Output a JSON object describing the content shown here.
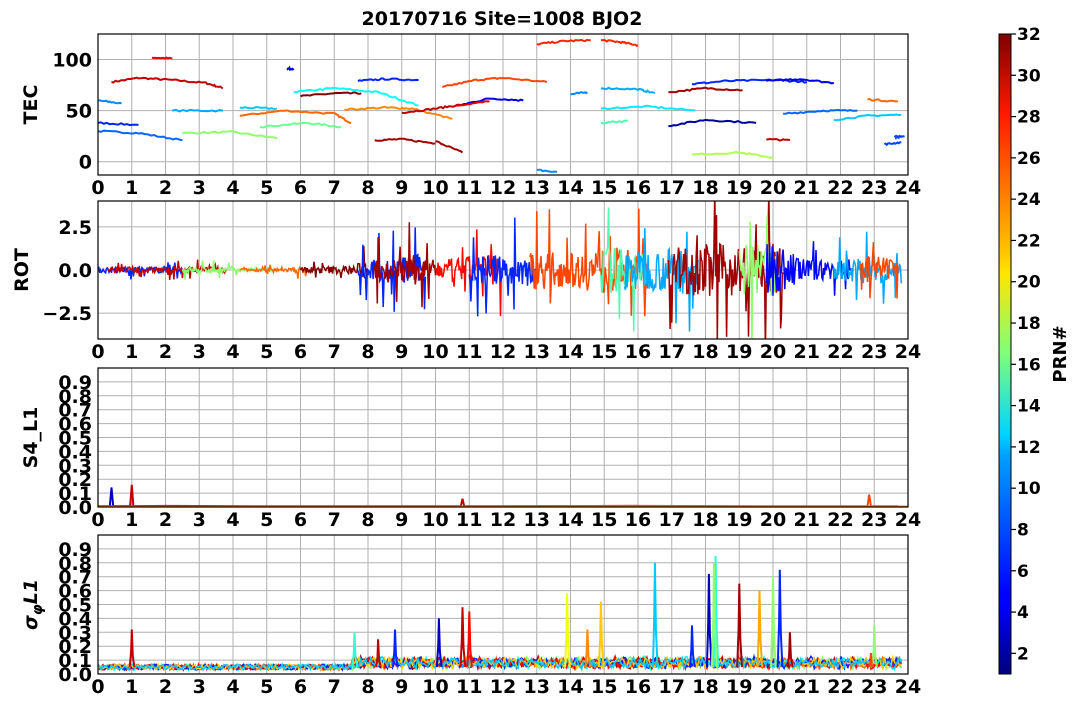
{
  "figure": {
    "title": "20170716 Site=1008 BJO2",
    "colorbar_label": "PRN#",
    "colorbar_range": [
      1,
      32
    ],
    "colorbar_ticks": [
      2,
      4,
      6,
      8,
      10,
      12,
      14,
      16,
      18,
      20,
      22,
      24,
      26,
      28,
      30,
      32
    ],
    "colormap": "jet"
  },
  "chart_data": [
    {
      "type": "line",
      "panel": "TEC",
      "title": "20170716 Site=1008 BJO2",
      "xlabel": "",
      "ylabel": "TEC",
      "xlim": [
        0,
        24
      ],
      "ylim": [
        -13,
        125
      ],
      "xticks": [
        0,
        1,
        2,
        3,
        4,
        5,
        6,
        7,
        8,
        9,
        10,
        11,
        12,
        13,
        14,
        15,
        16,
        17,
        18,
        19,
        20,
        21,
        22,
        23,
        24
      ],
      "yticks": [
        0,
        50,
        100
      ],
      "ytick_labels": [
        "0",
        "50",
        "100"
      ],
      "grid": true,
      "series": [
        {
          "prn": 30,
          "x": [
            0.4,
            1.2,
            2.2,
            3.2,
            3.7
          ],
          "y": [
            78,
            82,
            80,
            77,
            72
          ]
        },
        {
          "prn": 29,
          "x": [
            1.6,
            2.2
          ],
          "y": [
            102,
            101
          ]
        },
        {
          "prn": 9,
          "x": [
            0.0,
            0.7
          ],
          "y": [
            60,
            57
          ]
        },
        {
          "prn": 6,
          "x": [
            0.0,
            1.2
          ],
          "y": [
            38,
            36
          ]
        },
        {
          "prn": 8,
          "x": [
            0.0,
            1.2,
            2.5
          ],
          "y": [
            30,
            28,
            21
          ]
        },
        {
          "prn": 10,
          "x": [
            2.2,
            3.7
          ],
          "y": [
            50,
            50
          ]
        },
        {
          "prn": 17,
          "x": [
            2.5,
            4.0,
            5.3
          ],
          "y": [
            28,
            29,
            23
          ]
        },
        {
          "prn": 11,
          "x": [
            4.2,
            5.3
          ],
          "y": [
            53,
            52
          ]
        },
        {
          "prn": 25,
          "x": [
            4.2,
            5.5,
            7.0,
            7.5
          ],
          "y": [
            45,
            50,
            47,
            38
          ]
        },
        {
          "prn": 16,
          "x": [
            4.8,
            6.2,
            7.2
          ],
          "y": [
            34,
            38,
            34
          ]
        },
        {
          "prn": 4,
          "x": [
            5.6,
            5.8
          ],
          "y": [
            91,
            91
          ]
        },
        {
          "prn": 32,
          "x": [
            6.0,
            7.0,
            7.8
          ],
          "y": [
            64,
            67,
            67
          ]
        },
        {
          "prn": 13,
          "x": [
            5.8,
            7.0,
            8.3,
            9.5
          ],
          "y": [
            68,
            72,
            68,
            55
          ]
        },
        {
          "prn": 24,
          "x": [
            7.3,
            8.5,
            9.3,
            10.5
          ],
          "y": [
            51,
            53,
            52,
            42
          ]
        },
        {
          "prn": 6,
          "x": [
            7.7,
            8.5,
            9.5
          ],
          "y": [
            79,
            81,
            80
          ]
        },
        {
          "prn": 31,
          "x": [
            8.2,
            9.0,
            10.0
          ],
          "y": [
            21,
            22,
            18
          ]
        },
        {
          "prn": 30,
          "x": [
            9.0,
            10.0,
            10.8
          ],
          "y": [
            48,
            52,
            56
          ]
        },
        {
          "prn": 31,
          "x": [
            10.0,
            10.8
          ],
          "y": [
            20,
            9
          ]
        },
        {
          "prn": 26,
          "x": [
            10.2,
            11.2,
            12.0,
            13.3
          ],
          "y": [
            73,
            80,
            82,
            78
          ]
        },
        {
          "prn": 4,
          "x": [
            10.8,
            11.6,
            12.6
          ],
          "y": [
            56,
            62,
            60
          ]
        },
        {
          "prn": 29,
          "x": [
            10.6,
            11.6
          ],
          "y": [
            55,
            59
          ]
        },
        {
          "prn": 27,
          "x": [
            13.0,
            13.8,
            14.6
          ],
          "y": [
            115,
            118,
            119
          ]
        },
        {
          "prn": 27,
          "x": [
            14.9,
            15.5,
            16.0
          ],
          "y": [
            119,
            117,
            114
          ]
        },
        {
          "prn": 9,
          "x": [
            13.0,
            13.6
          ],
          "y": [
            -8,
            -10
          ]
        },
        {
          "prn": 9,
          "x": [
            14.0,
            14.5
          ],
          "y": [
            66,
            68
          ]
        },
        {
          "prn": 10,
          "x": [
            14.9,
            16.0,
            16.5
          ],
          "y": [
            72,
            71,
            67
          ]
        },
        {
          "prn": 12,
          "x": [
            14.9,
            16.3,
            17.7
          ],
          "y": [
            52,
            54,
            50
          ]
        },
        {
          "prn": 15,
          "x": [
            14.9,
            15.7
          ],
          "y": [
            38,
            40
          ]
        },
        {
          "prn": 31,
          "x": [
            16.9,
            18.0,
            19.1
          ],
          "y": [
            68,
            72,
            70
          ]
        },
        {
          "prn": 6,
          "x": [
            17.6,
            18.6,
            20.1,
            21.0
          ],
          "y": [
            76,
            79,
            80,
            78
          ]
        },
        {
          "prn": 4,
          "x": [
            19.8,
            20.8,
            21.8
          ],
          "y": [
            79,
            81,
            77
          ]
        },
        {
          "prn": 2,
          "x": [
            16.9,
            18.0,
            19.5
          ],
          "y": [
            35,
            41,
            38
          ]
        },
        {
          "prn": 18,
          "x": [
            17.6,
            19.0,
            20.0
          ],
          "y": [
            7,
            9,
            4
          ]
        },
        {
          "prn": 30,
          "x": [
            19.8,
            20.5
          ],
          "y": [
            22,
            21
          ]
        },
        {
          "prn": 8,
          "x": [
            20.3,
            21.5,
            22.5
          ],
          "y": [
            47,
            50,
            50
          ]
        },
        {
          "prn": 11,
          "x": [
            21.8,
            22.8,
            23.8
          ],
          "y": [
            41,
            45,
            46
          ]
        },
        {
          "prn": 25,
          "x": [
            22.8,
            23.7
          ],
          "y": [
            61,
            59
          ]
        },
        {
          "prn": 7,
          "x": [
            23.3,
            23.8
          ],
          "y": [
            17,
            19
          ]
        },
        {
          "prn": 7,
          "x": [
            23.6,
            23.9
          ],
          "y": [
            24,
            25
          ]
        }
      ]
    },
    {
      "type": "line",
      "panel": "ROT",
      "xlabel": "",
      "ylabel": "ROT",
      "xlim": [
        0,
        24
      ],
      "ylim": [
        -4,
        4
      ],
      "xticks": [
        0,
        1,
        2,
        3,
        4,
        5,
        6,
        7,
        8,
        9,
        10,
        11,
        12,
        13,
        14,
        15,
        16,
        17,
        18,
        19,
        20,
        21,
        22,
        23,
        24
      ],
      "yticks": [
        -2.5,
        0,
        2.5
      ],
      "ytick_labels": [
        "−2.5",
        "0.0",
        "2.5"
      ],
      "grid": true,
      "noise_envelope": {
        "x": [
          0,
          3.7,
          4.2,
          5.5,
          6,
          7.5,
          8,
          9.5,
          10,
          11.5,
          12,
          13,
          14,
          15,
          16,
          17,
          18,
          19,
          20,
          21,
          22,
          23,
          23.8
        ],
        "amp": [
          0.3,
          0.3,
          0.15,
          0.15,
          0.3,
          0.4,
          1.0,
          1.5,
          0.9,
          1.6,
          1.3,
          1.9,
          1.6,
          2.4,
          1.8,
          2.2,
          2.6,
          2.4,
          2.6,
          1.0,
          1.0,
          1.4,
          0.8
        ]
      },
      "series": [
        {
          "prn": 6,
          "x_range": [
            0.0,
            2.5
          ]
        },
        {
          "prn": 30,
          "x_range": [
            0.3,
            3.8
          ]
        },
        {
          "prn": 17,
          "x_range": [
            2.5,
            5.3
          ]
        },
        {
          "prn": 25,
          "x_range": [
            4.2,
            6.2
          ]
        },
        {
          "prn": 32,
          "x_range": [
            6.0,
            8.0
          ]
        },
        {
          "prn": 6,
          "x_range": [
            7.7,
            9.7
          ]
        },
        {
          "prn": 31,
          "x_range": [
            8.2,
            10.0
          ]
        },
        {
          "prn": 28,
          "x_range": [
            10.0,
            12.0
          ]
        },
        {
          "prn": 6,
          "x_range": [
            11.0,
            13.0
          ]
        },
        {
          "prn": 26,
          "x_range": [
            12.8,
            16.3
          ]
        },
        {
          "prn": 15,
          "x_range": [
            14.9,
            16.2
          ]
        },
        {
          "prn": 10,
          "x_range": [
            15.6,
            17.8
          ]
        },
        {
          "prn": 31,
          "x_range": [
            16.9,
            20.3
          ]
        },
        {
          "prn": 17,
          "x_range": [
            19.0,
            20.1
          ]
        },
        {
          "prn": 5,
          "x_range": [
            19.8,
            22.3
          ]
        },
        {
          "prn": 10,
          "x_range": [
            21.8,
            23.8
          ]
        },
        {
          "prn": 26,
          "x_range": [
            22.6,
            23.7
          ]
        }
      ]
    },
    {
      "type": "line",
      "panel": "S4",
      "xlabel": "",
      "ylabel": "S4_L1",
      "xlim": [
        0,
        24
      ],
      "ylim": [
        0,
        1
      ],
      "xticks": [
        0,
        1,
        2,
        3,
        4,
        5,
        6,
        7,
        8,
        9,
        10,
        11,
        12,
        13,
        14,
        15,
        16,
        17,
        18,
        19,
        20,
        21,
        22,
        23,
        24
      ],
      "yticks": [
        0,
        0.1,
        0.2,
        0.3,
        0.4,
        0.5,
        0.6,
        0.7,
        0.8,
        0.9
      ],
      "ytick_labels": [
        "0.0",
        "0.1",
        "0.2",
        "0.3",
        "0.4",
        "0.5",
        "0.6",
        "0.7",
        "0.8",
        "0.9"
      ],
      "grid": true,
      "series": [
        {
          "prn": 3,
          "x": [
            0.0,
            0.35,
            0.4,
            0.45,
            1.0,
            2.0,
            2.5
          ],
          "y": [
            0.005,
            0.005,
            0.14,
            0.005,
            0.005,
            0.005,
            0.005
          ]
        },
        {
          "prn": 30,
          "x": [
            0.3,
            0.95,
            1.0,
            1.05,
            2.0,
            5.0,
            10.0,
            10.75,
            10.8,
            10.85,
            12.0,
            16.0
          ],
          "y": [
            0.005,
            0.005,
            0.16,
            0.005,
            0.008,
            0.005,
            0.005,
            0.005,
            0.06,
            0.005,
            0.005,
            0.008
          ]
        },
        {
          "prn": 26,
          "x": [
            12.0,
            16.0,
            20.0,
            22.8,
            22.85,
            22.9,
            23.0,
            23.7
          ],
          "y": [
            0.005,
            0.008,
            0.005,
            0.005,
            0.09,
            0.005,
            0.005,
            0.005
          ]
        },
        {
          "prn": 25,
          "x": [
            0.0,
            24.0
          ],
          "y": [
            0.003,
            0.003
          ]
        }
      ]
    },
    {
      "type": "line",
      "panel": "sigma_phi",
      "xlabel": "",
      "ylabel": "σ_φ L1",
      "xlim": [
        0,
        24
      ],
      "ylim": [
        0,
        1
      ],
      "xticks": [
        0,
        1,
        2,
        3,
        4,
        5,
        6,
        7,
        8,
        9,
        10,
        11,
        12,
        13,
        14,
        15,
        16,
        17,
        18,
        19,
        20,
        21,
        22,
        23,
        24
      ],
      "yticks": [
        0,
        0.1,
        0.2,
        0.3,
        0.4,
        0.5,
        0.6,
        0.7,
        0.8,
        0.9
      ],
      "ytick_labels": [
        "0.0",
        "0.1",
        "0.2",
        "0.3",
        "0.4",
        "0.5",
        "0.6",
        "0.7",
        "0.8",
        "0.9"
      ],
      "grid": true,
      "baseline": 0.05,
      "spikes": [
        {
          "x": 1.0,
          "y": 0.32,
          "prn": 30
        },
        {
          "x": 7.6,
          "y": 0.3,
          "prn": 14
        },
        {
          "x": 8.3,
          "y": 0.25,
          "prn": 30
        },
        {
          "x": 8.8,
          "y": 0.32,
          "prn": 6
        },
        {
          "x": 10.1,
          "y": 0.4,
          "prn": 3
        },
        {
          "x": 10.8,
          "y": 0.48,
          "prn": 30
        },
        {
          "x": 11.0,
          "y": 0.45,
          "prn": 28
        },
        {
          "x": 13.9,
          "y": 0.58,
          "prn": 20
        },
        {
          "x": 14.5,
          "y": 0.32,
          "prn": 24
        },
        {
          "x": 14.9,
          "y": 0.52,
          "prn": 22
        },
        {
          "x": 16.5,
          "y": 0.8,
          "prn": 11
        },
        {
          "x": 17.6,
          "y": 0.35,
          "prn": 6
        },
        {
          "x": 18.1,
          "y": 0.72,
          "prn": 3
        },
        {
          "x": 18.3,
          "y": 0.85,
          "prn": 14
        },
        {
          "x": 18.25,
          "y": 0.8,
          "prn": 17
        },
        {
          "x": 19.0,
          "y": 0.65,
          "prn": 31
        },
        {
          "x": 19.6,
          "y": 0.6,
          "prn": 23
        },
        {
          "x": 20.0,
          "y": 0.7,
          "prn": 17
        },
        {
          "x": 20.2,
          "y": 0.75,
          "prn": 6
        },
        {
          "x": 20.5,
          "y": 0.3,
          "prn": 31
        },
        {
          "x": 23.0,
          "y": 0.35,
          "prn": 17
        },
        {
          "x": 22.9,
          "y": 0.15,
          "prn": 26
        }
      ]
    }
  ]
}
